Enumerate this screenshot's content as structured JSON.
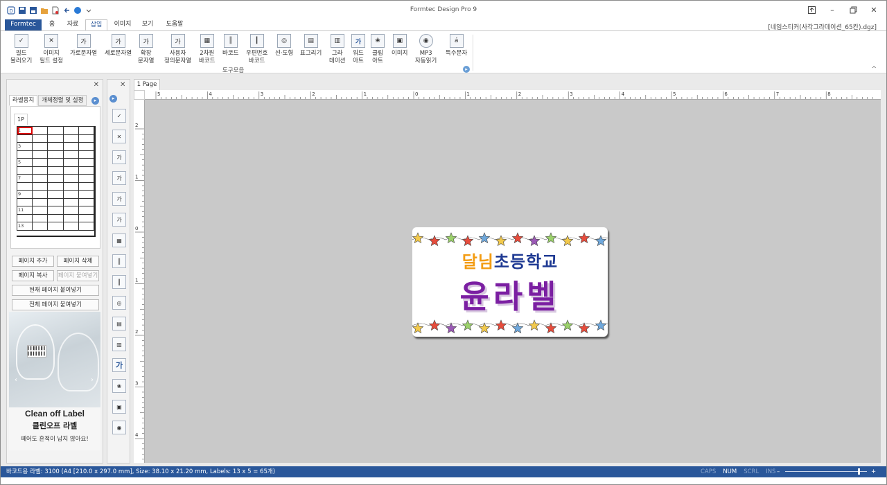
{
  "window": {
    "title": "Formtec Design Pro 9",
    "filename": "[네임스티커(사각그라데이션_65칸).dgz]"
  },
  "menu": {
    "tabs": [
      "Formtec",
      "홈",
      "자료",
      "삽입",
      "이미지",
      "보기",
      "도움말"
    ],
    "active": "삽입"
  },
  "ribbon": {
    "buttons": [
      {
        "label": "필드\n불러오기",
        "icon": "field-load-icon"
      },
      {
        "label": "이미지\n필드 설정",
        "icon": "image-field-icon"
      },
      {
        "label": "가로문자열",
        "icon": "horizontal-text-icon"
      },
      {
        "label": "세로문자열",
        "icon": "vertical-text-icon"
      },
      {
        "label": "확장\n문자열",
        "icon": "extended-text-icon"
      },
      {
        "label": "사용자\n정의문자열",
        "icon": "custom-text-icon"
      },
      {
        "label": "2차원\n바코드",
        "icon": "qr-code-icon"
      },
      {
        "label": "바코드",
        "icon": "barcode-icon"
      },
      {
        "label": "우편번호\n바코드",
        "icon": "postal-barcode-icon"
      },
      {
        "label": "선·도형",
        "icon": "shapes-icon"
      },
      {
        "label": "표그리기",
        "icon": "table-icon"
      },
      {
        "label": "그라\n데이션",
        "icon": "gradient-icon"
      },
      {
        "label": "워드\n아트",
        "icon": "wordart-icon"
      },
      {
        "label": "클립\n아트",
        "icon": "clipart-icon"
      },
      {
        "label": "이미지",
        "icon": "image-icon"
      },
      {
        "label": "MP3\n자동읽기",
        "icon": "mp3-icon"
      },
      {
        "label": "특수문자",
        "icon": "special-char-icon"
      }
    ],
    "group_label": "도구모음"
  },
  "left_panel": {
    "tabs": [
      "라벨용지",
      "개체정렬 및 설정"
    ],
    "page_tab": "1P",
    "row_numbers": [
      "1",
      "3",
      "5",
      "7",
      "9",
      "11",
      "13"
    ],
    "buttons": {
      "add_page": "페이지 추가",
      "delete_page": "페이지 삭제",
      "copy_page": "페이지 복사",
      "paste_page": "페이지 붙여넣기",
      "paste_current": "현재 페이지 붙여넣기",
      "paste_all": "전체 페이지 붙여넣기"
    },
    "ad": {
      "brand": "Clean off Label",
      "name": "클린오프 라벨",
      "tagline": "떼어도 흔적이 남지 않아요!"
    }
  },
  "document": {
    "tab": "1 Page",
    "hruler_labels": [
      "5",
      "4",
      "3",
      "2",
      "1",
      "0",
      "1",
      "2",
      "3",
      "4",
      "5",
      "6",
      "7",
      "8"
    ],
    "vruler_labels": [
      "2",
      "1",
      "0",
      "1",
      "2",
      "3",
      "4"
    ],
    "label": {
      "school_parts": [
        {
          "text": "달님",
          "color": "#f39c12"
        },
        {
          "text": "초등학교",
          "color": "#1f3a93"
        }
      ],
      "name": "윤라벨"
    }
  },
  "status": {
    "text": "바코드용 라벨: 3100 (A4 [210.0 x 297.0 mm], Size: 38.10 x 21.20 mm,  Labels: 13 x 5 = 65개)",
    "keys": [
      "CAPS",
      "NUM",
      "SCRL",
      "INS"
    ],
    "active_key": "NUM",
    "zoom_fraction": 0.9
  }
}
